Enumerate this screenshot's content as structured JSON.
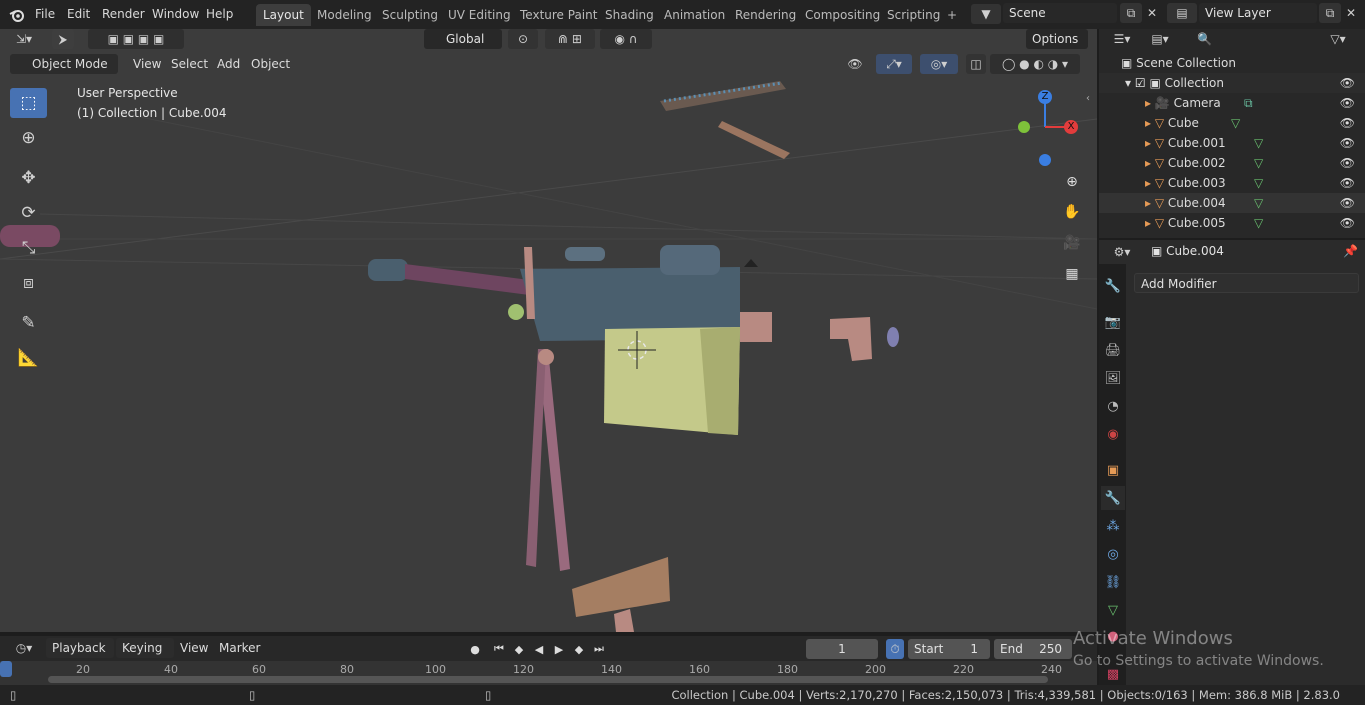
{
  "app": {
    "logo_icon": "blender-logo-icon"
  },
  "menu": {
    "file": "File",
    "edit": "Edit",
    "render": "Render",
    "window": "Window",
    "help": "Help"
  },
  "workspaces": [
    "Layout",
    "Modeling",
    "Sculpting",
    "UV Editing",
    "Texture Paint",
    "Shading",
    "Animation",
    "Rendering",
    "Compositing",
    "Scripting"
  ],
  "add_workspace": "+",
  "scene": {
    "name": "Scene",
    "view_layer": "View Layer"
  },
  "toolbar": {
    "orientation": "Global",
    "options": "Options"
  },
  "viewport_header": {
    "mode": "Object Mode",
    "view": "View",
    "select": "Select",
    "add": "Add",
    "object": "Object"
  },
  "viewport": {
    "perspective_label": "User Perspective",
    "collection_label": "(1) Collection | Cube.004",
    "gizmo": {
      "z": "Z",
      "x": "X"
    }
  },
  "outliner": {
    "root": "Scene Collection",
    "collection": "Collection",
    "items": [
      "Camera",
      "Cube",
      "Cube.001",
      "Cube.002",
      "Cube.003",
      "Cube.004",
      "Cube.005"
    ],
    "selected": "Cube.004"
  },
  "properties": {
    "object_name": "Cube.004",
    "add_modifier": "Add Modifier"
  },
  "timeline": {
    "playback": "Playback",
    "keying": "Keying",
    "view": "View",
    "marker": "Marker",
    "current_frame": "1",
    "start_label": "Start",
    "start_value": "1",
    "end_label": "End",
    "end_value": "250",
    "ticks": [
      "20",
      "40",
      "60",
      "80",
      "100",
      "120",
      "140",
      "160",
      "180",
      "200",
      "220",
      "240"
    ]
  },
  "status": {
    "text": "Collection | Cube.004 | Verts:2,170,270 | Faces:2,150,073 | Tris:4,339,581 | Objects:0/163 | Mem: 386.8 MiB | 2.83.0"
  },
  "watermark": {
    "line1": "Activate Windows",
    "line2": "Go to Settings to activate Windows."
  },
  "colors": {
    "accent": "#4772b3",
    "gun_body": "#4a5f6e",
    "receiver": "#c4c98a",
    "barrel": "#6e4560",
    "furniture": "#b88a82",
    "gizmo_x": "#e23c3c",
    "gizmo_y": "#7ec23a",
    "gizmo_z": "#3a7ee2"
  }
}
